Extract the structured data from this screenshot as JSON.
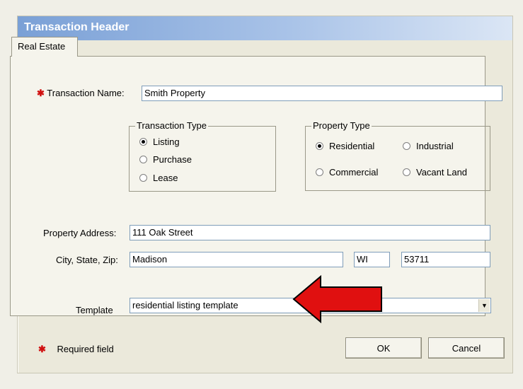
{
  "dialog": {
    "title": "Transaction Header",
    "tab_label": "Real Estate",
    "required_marker": "✱",
    "transaction_name_label": "Transaction Name:",
    "transaction_name_value": "Smith Property",
    "transaction_type": {
      "legend": "Transaction Type",
      "options": [
        {
          "label": "Listing",
          "selected": true
        },
        {
          "label": "Purchase",
          "selected": false
        },
        {
          "label": "Lease",
          "selected": false
        }
      ]
    },
    "property_type": {
      "legend": "Property Type",
      "options": [
        {
          "label": "Residential",
          "selected": true
        },
        {
          "label": "Industrial",
          "selected": false
        },
        {
          "label": "Commercial",
          "selected": false
        },
        {
          "label": "Vacant Land",
          "selected": false
        }
      ]
    },
    "property_address_label": "Property Address:",
    "property_address_value": "111 Oak Street",
    "city_state_zip_label": "City, State, Zip:",
    "city_value": "Madison",
    "state_value": "WI",
    "zip_value": "53711",
    "template_label": "Template",
    "template_value": "residential listing template",
    "required_field_text": "Required field",
    "ok_label": "OK",
    "cancel_label": "Cancel"
  },
  "colors": {
    "annotation_arrow": "#e01010",
    "required_marker": "#d01010"
  },
  "icons": {
    "dropdown": "chevron-down-icon",
    "annotation": "red-arrow-icon"
  }
}
